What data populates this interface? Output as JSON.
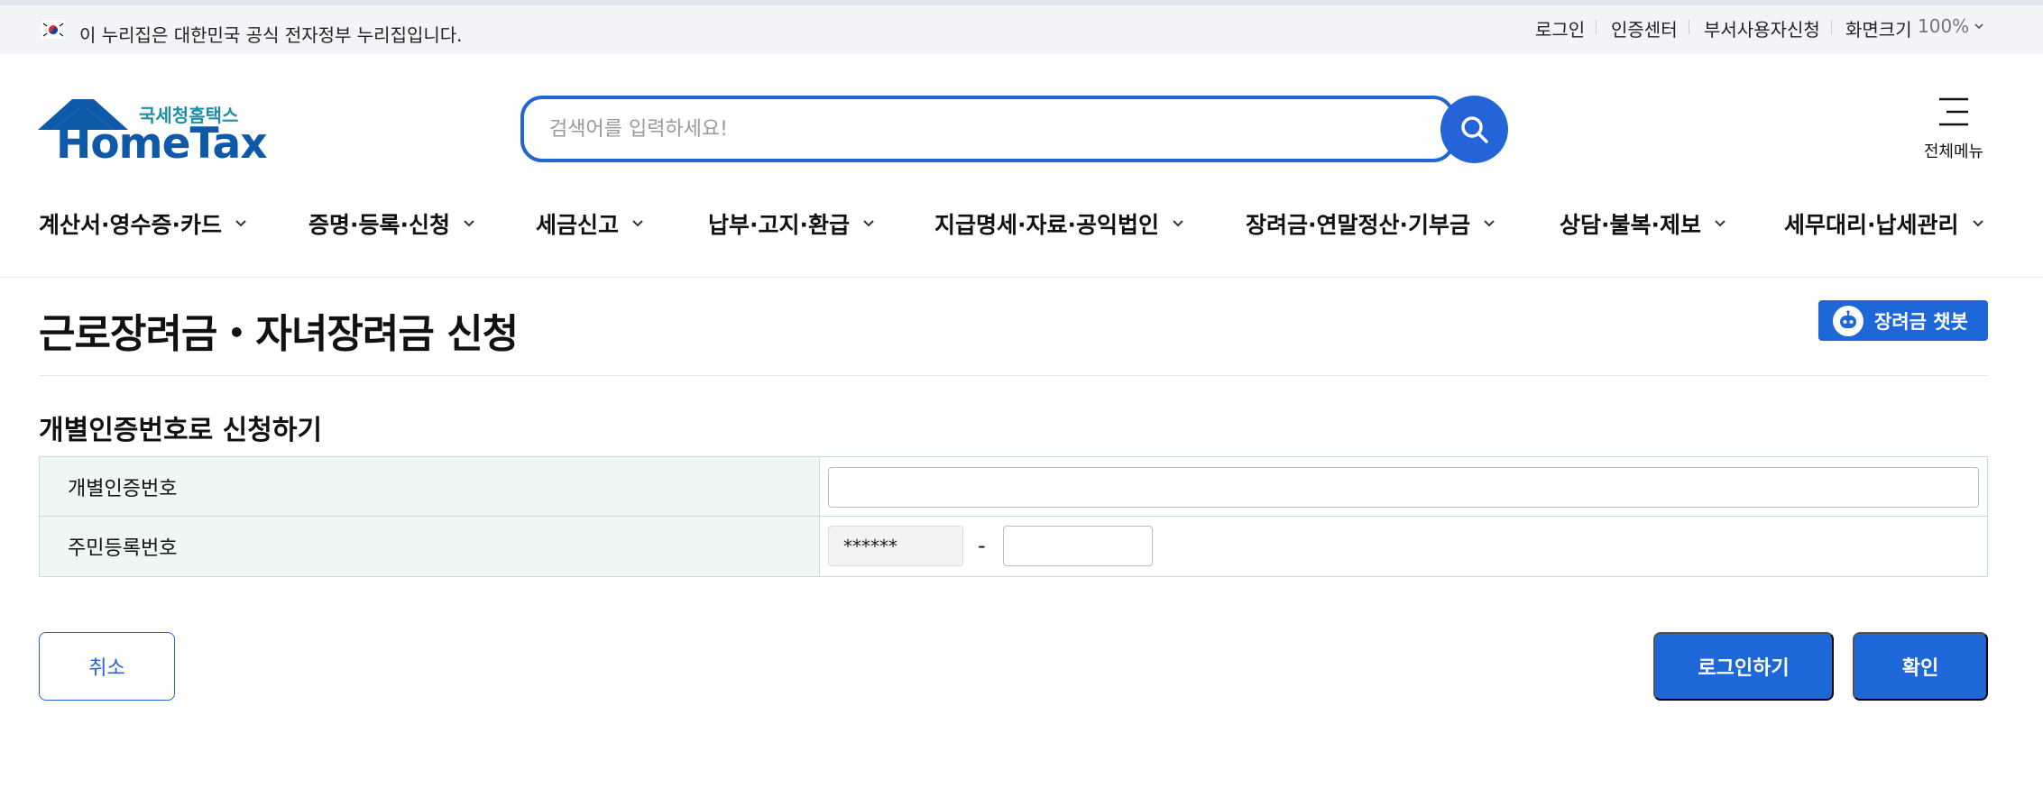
{
  "gov_banner": {
    "flag_icon": "korea-flag-icon",
    "text": "이 누리집은 대한민국 공식 전자정부 누리집입니다.",
    "utility_links": [
      {
        "label": "로그인"
      },
      {
        "label": "인증센터"
      },
      {
        "label": "부서사용자신청"
      }
    ],
    "zoom": {
      "label": "화면크기",
      "value": "100%"
    }
  },
  "header": {
    "logo": {
      "subtitle": "국세청홈택스",
      "title": "HomeTax"
    },
    "search": {
      "placeholder": "검색어를 입력하세요!",
      "value": "",
      "icon": "search-icon"
    },
    "all_menu": {
      "label": "전체메뉴",
      "icon": "hamburger-icon"
    }
  },
  "nav": {
    "items": [
      {
        "label": "계산서·영수증·카드"
      },
      {
        "label": "증명·등록·신청"
      },
      {
        "label": "세금신고"
      },
      {
        "label": "납부·고지·환급"
      },
      {
        "label": "지급명세·자료·공익법인"
      },
      {
        "label": "장려금·연말정산·기부금"
      },
      {
        "label": "상담·불복·제보"
      },
      {
        "label": "세무대리·납세관리"
      }
    ]
  },
  "page": {
    "title": "근로장려금・자녀장려금 신청",
    "chatbot_button": {
      "label": "장려금 챗봇",
      "icon": "chatbot-icon"
    }
  },
  "form": {
    "section_title": "개별인증번호로 신청하기",
    "rows": [
      {
        "label": "개별인증번호",
        "value": ""
      },
      {
        "label": "주민등록번호",
        "front_masked": "******",
        "separator": "-",
        "back_value": ""
      }
    ]
  },
  "actions": {
    "cancel_label": "취소",
    "login_label": "로그인하기",
    "confirm_label": "확인"
  },
  "colors": {
    "primary": "#1e67d9",
    "search_border": "#2563d8",
    "logo_blue": "#0e5aa8",
    "logo_teal": "#1f8ea7",
    "table_header_bg": "#eef7f6",
    "table_border": "#bfe0da",
    "banner_bg": "#f2f4f7"
  }
}
